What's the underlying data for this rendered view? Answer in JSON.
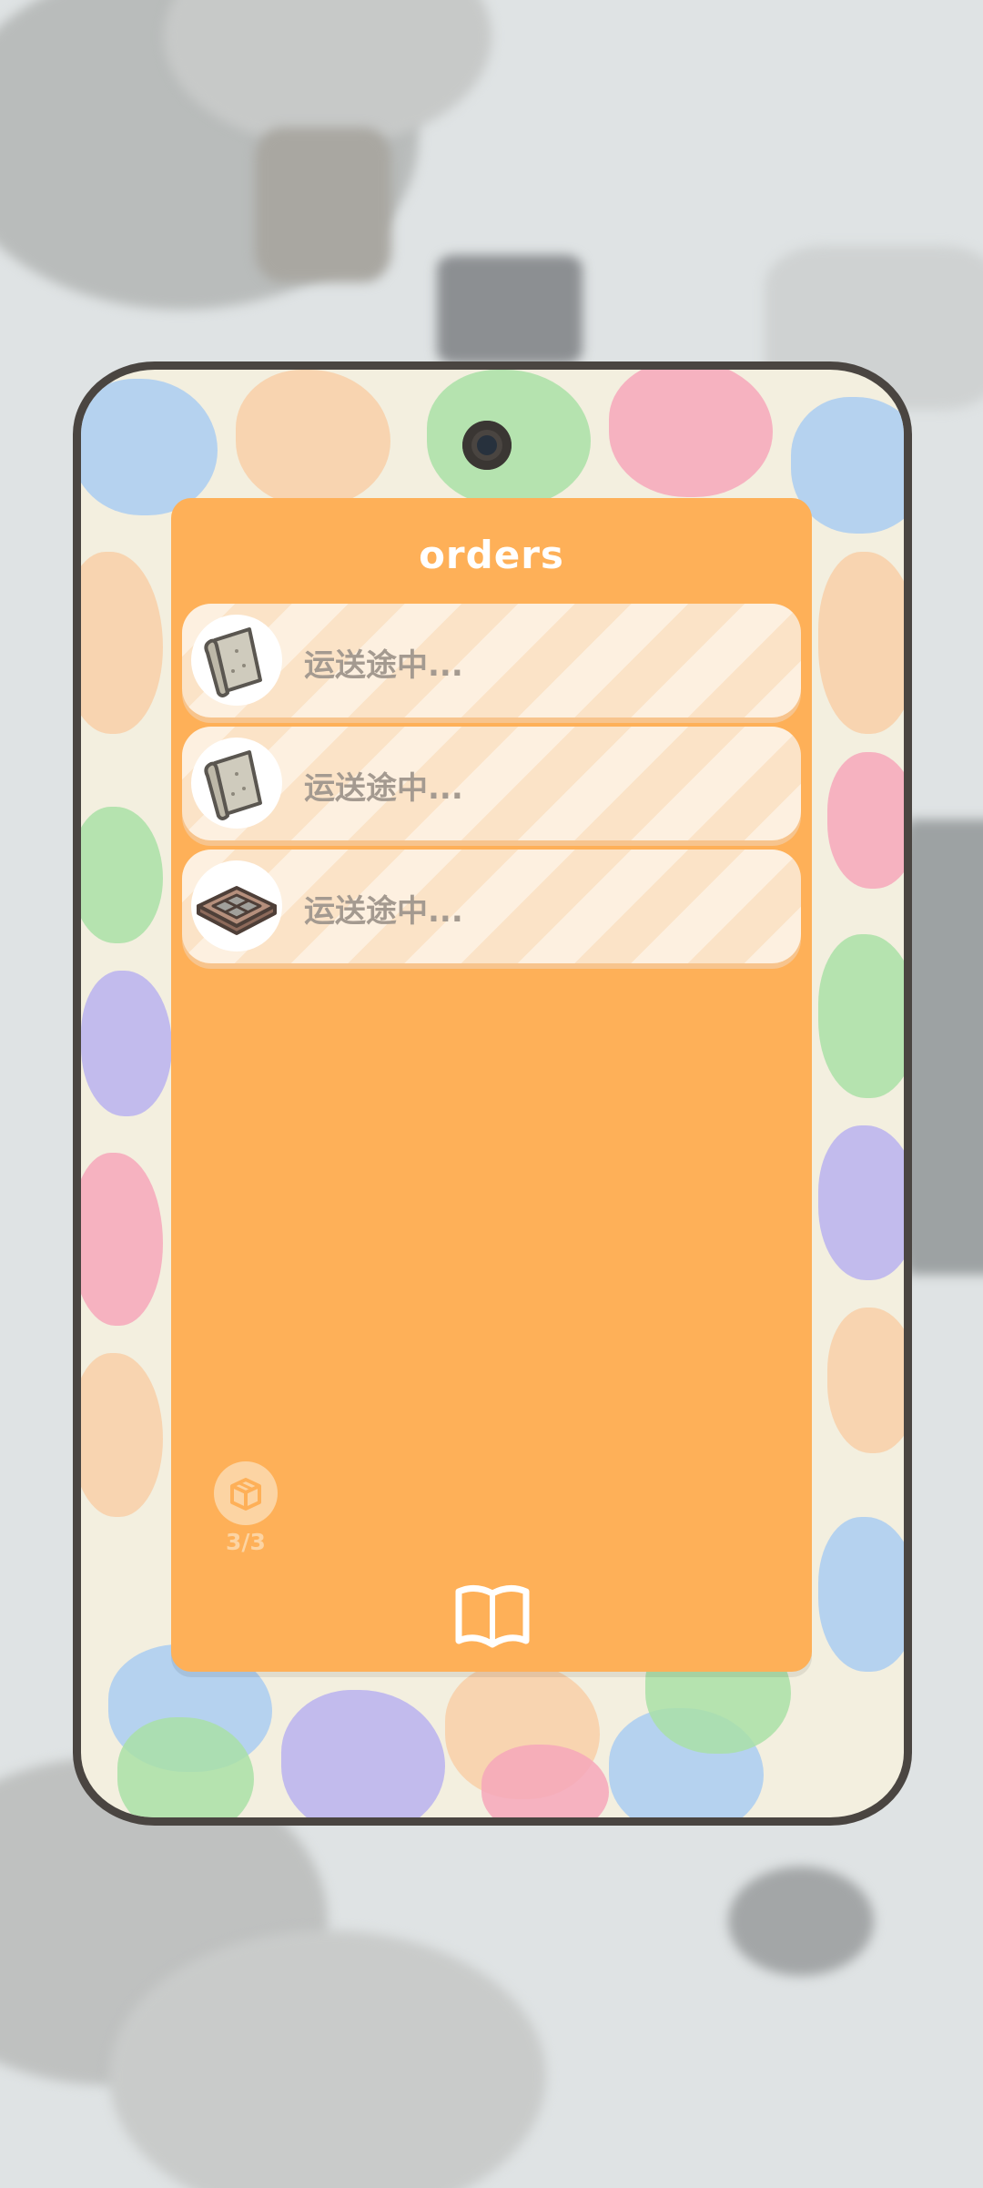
{
  "panel": {
    "title": "orders",
    "background_color": "#feb058"
  },
  "orders": [
    {
      "status": "运送途中...",
      "item_icon": "rolled-scroll-icon"
    },
    {
      "status": "运送途中...",
      "item_icon": "rolled-scroll-icon"
    },
    {
      "status": "运送途中...",
      "item_icon": "wooden-crate-icon"
    }
  ],
  "capacity": {
    "text": "3/3",
    "icon": "package-box-icon"
  },
  "footer": {
    "icon": "open-book-icon"
  }
}
